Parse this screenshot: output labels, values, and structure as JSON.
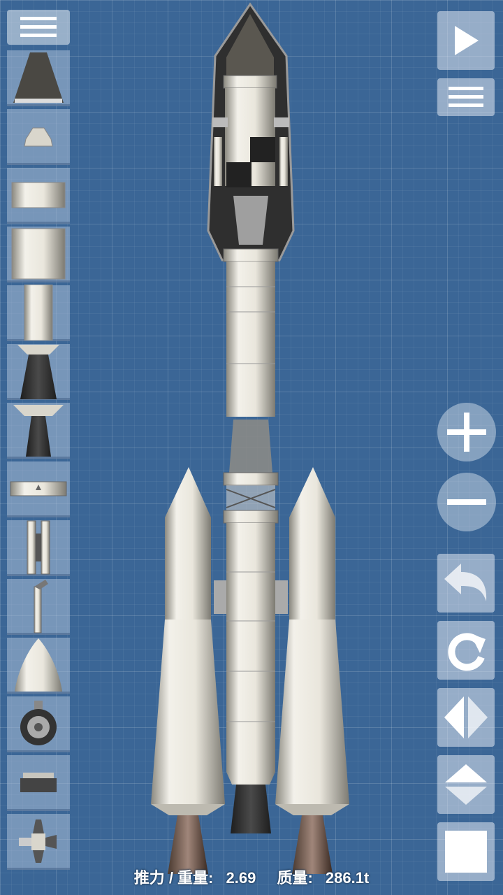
{
  "app": {
    "toolbar_left": {
      "menu_icon": "hamburger-icon",
      "parts": [
        {
          "name": "engine-nozzle-large",
          "icon": "engine-cone-icon"
        },
        {
          "name": "capsule-small",
          "icon": "capsule-icon"
        },
        {
          "name": "fuel-tank-short",
          "icon": "fuel-tank-short-icon"
        },
        {
          "name": "fuel-tank-medium",
          "icon": "fuel-tank-medium-icon"
        },
        {
          "name": "fuel-tank-tall",
          "icon": "fuel-tank-tall-icon"
        },
        {
          "name": "engine-titan",
          "icon": "engine-bell-icon"
        },
        {
          "name": "engine-valiant",
          "icon": "engine-bell-small-icon"
        },
        {
          "name": "separator",
          "icon": "separator-icon"
        },
        {
          "name": "side-separator",
          "icon": "side-separator-icon"
        },
        {
          "name": "parachute",
          "icon": "parachute-icon"
        },
        {
          "name": "nose-cone",
          "icon": "nose-cone-icon"
        },
        {
          "name": "wheel",
          "icon": "wheel-icon"
        },
        {
          "name": "docking-port",
          "icon": "docking-port-icon"
        },
        {
          "name": "rcs-thruster",
          "icon": "rcs-icon"
        }
      ]
    },
    "toolbar_right": {
      "launch": "play-icon",
      "options": "hamburger-icon",
      "zoom_in": "plus-icon",
      "zoom_out": "minus-icon",
      "undo": "undo-icon",
      "redo": "redo-icon",
      "flip_horizontal": "flip-horizontal-icon",
      "flip_vertical": "flip-vertical-icon",
      "stop": "square-icon"
    },
    "status": {
      "twr_label": "推力 / 重量:",
      "twr_value": "2.69",
      "mass_label": "质量:",
      "mass_value": "286.1t"
    },
    "colors": {
      "background": "#3b6696",
      "part_body": "#e9e6dc",
      "part_dark": "#2f2f2f",
      "button_bg": "#dfe6f0"
    }
  }
}
